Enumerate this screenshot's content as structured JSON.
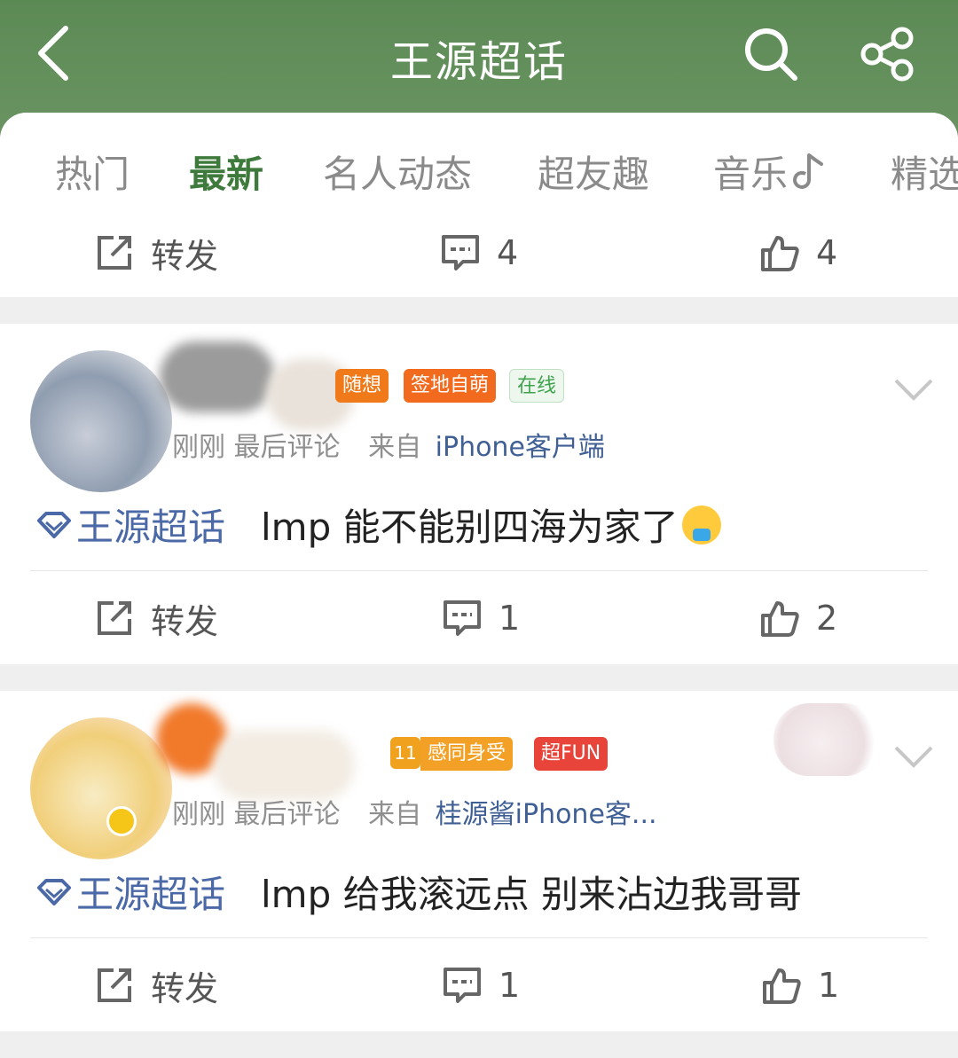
{
  "header": {
    "title": "王源超话"
  },
  "tabs": [
    {
      "label": "热门"
    },
    {
      "label": "最新"
    },
    {
      "label": "名人动态"
    },
    {
      "label": "超友趣"
    },
    {
      "label": "音乐"
    },
    {
      "label": "精选"
    }
  ],
  "top_actions": {
    "repost": "转发",
    "comments": "4",
    "likes": "4"
  },
  "posts": [
    {
      "badges": [
        "随想",
        "签地自萌",
        "在线"
      ],
      "meta_time": "刚刚 最后评论",
      "meta_from": "来自",
      "meta_source": "iPhone客户端",
      "topic": "王源超话",
      "text": "lmp 能不能别四海为家了",
      "actions": {
        "repost": "转发",
        "comments": "1",
        "likes": "2"
      }
    },
    {
      "badges": [
        "感同身受",
        "超FUN"
      ],
      "level": "11",
      "meta_time": "刚刚 最后评论",
      "meta_from": "来自",
      "meta_source": "桂源酱iPhone客...",
      "topic": "王源超话",
      "text": "lmp 给我滚远点 别来沾边我哥哥",
      "actions": {
        "repost": "转发",
        "comments": "1",
        "likes": "1"
      }
    }
  ],
  "colors": {
    "header_bg": "#5c8a55",
    "active_tab": "#3e7a3b",
    "topic_link": "#4a69a6",
    "badge_orange": "#f2741b",
    "badge_green": "#3fa34d",
    "badge_red": "#e8443a"
  }
}
